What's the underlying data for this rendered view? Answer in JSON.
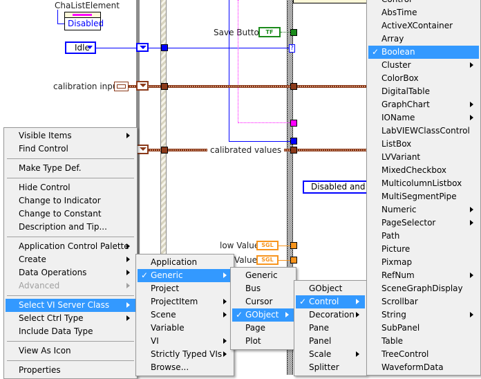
{
  "diagram": {
    "cha_list_element_label": "ChaListElement",
    "disabled_label": "Disabled",
    "idle_enum": "Idle",
    "calibration_input_label": "calibration input",
    "save_button_label": "Save Button",
    "save_button_type": "TF",
    "calibrated_values_label": "calibrated values",
    "disabled_and_label": "Disabled and G",
    "low_value_label": "low Value",
    "high_value_label": "Value",
    "sgl_type": "SGL",
    "case_selector": "?"
  },
  "context_menu": {
    "items": [
      {
        "label": "Visible Items",
        "submenu": true
      },
      {
        "label": "Find Control"
      },
      {
        "sep": true
      },
      {
        "label": "Make Type Def."
      },
      {
        "sep": true
      },
      {
        "label": "Hide Control"
      },
      {
        "label": "Change to Indicator"
      },
      {
        "label": "Change to Constant"
      },
      {
        "label": "Description and Tip..."
      },
      {
        "sep": true
      },
      {
        "label": "Application Control Palette",
        "submenu": true
      },
      {
        "label": "Create",
        "submenu": true
      },
      {
        "label": "Data Operations",
        "submenu": true
      },
      {
        "label": "Advanced",
        "submenu": true,
        "disabled": true
      },
      {
        "sep": true
      },
      {
        "label": "Select VI Server Class",
        "submenu": true,
        "highlighted": true
      },
      {
        "label": "Select Ctrl Type",
        "submenu": true
      },
      {
        "label": "Include Data Type"
      },
      {
        "sep": true
      },
      {
        "label": "View As Icon"
      },
      {
        "sep": true
      },
      {
        "label": "Properties"
      }
    ]
  },
  "server_class_menu": {
    "items": [
      {
        "label": "Application"
      },
      {
        "label": "Generic",
        "submenu": true,
        "highlighted": true,
        "checked": true
      },
      {
        "label": "Project"
      },
      {
        "label": "ProjectItem",
        "submenu": true
      },
      {
        "label": "Scene",
        "submenu": true
      },
      {
        "label": "Variable"
      },
      {
        "label": "VI",
        "submenu": true
      },
      {
        "label": "Strictly Typed VIs",
        "submenu": true
      },
      {
        "label": "Browse..."
      }
    ]
  },
  "generic_menu": {
    "items": [
      {
        "label": "Generic"
      },
      {
        "label": "Bus"
      },
      {
        "label": "Cursor"
      },
      {
        "label": "GObject",
        "submenu": true,
        "highlighted": true,
        "checked": true
      },
      {
        "label": "Page"
      },
      {
        "label": "Plot"
      }
    ]
  },
  "gobject_menu": {
    "items": [
      {
        "label": "GObject"
      },
      {
        "label": "Control",
        "submenu": true,
        "highlighted": true,
        "checked": true
      },
      {
        "label": "Decoration",
        "submenu": true
      },
      {
        "label": "Pane"
      },
      {
        "label": "Panel"
      },
      {
        "label": "Scale",
        "submenu": true
      },
      {
        "label": "Splitter"
      }
    ]
  },
  "control_menu": {
    "items": [
      {
        "label": "Control"
      },
      {
        "label": "AbsTime"
      },
      {
        "label": "ActiveXContainer"
      },
      {
        "label": "Array"
      },
      {
        "label": "Boolean",
        "highlighted": true,
        "checked": true
      },
      {
        "label": "Cluster",
        "submenu": true
      },
      {
        "label": "ColorBox"
      },
      {
        "label": "DigitalTable"
      },
      {
        "label": "GraphChart",
        "submenu": true
      },
      {
        "label": "IOName",
        "submenu": true
      },
      {
        "label": "LabVIEWClassControl"
      },
      {
        "label": "ListBox"
      },
      {
        "label": "LVVariant"
      },
      {
        "label": "MixedCheckbox"
      },
      {
        "label": "MulticolumnListbox"
      },
      {
        "label": "MultiSegmentPipe"
      },
      {
        "label": "Numeric",
        "submenu": true
      },
      {
        "label": "PageSelector",
        "submenu": true
      },
      {
        "label": "Path"
      },
      {
        "label": "Picture"
      },
      {
        "label": "Pixmap"
      },
      {
        "label": "RefNum",
        "submenu": true
      },
      {
        "label": "SceneGraphDisplay"
      },
      {
        "label": "Scrollbar"
      },
      {
        "label": "String",
        "submenu": true
      },
      {
        "label": "SubPanel"
      },
      {
        "label": "Table"
      },
      {
        "label": "TreeControl"
      },
      {
        "label": "WaveformData"
      }
    ]
  }
}
